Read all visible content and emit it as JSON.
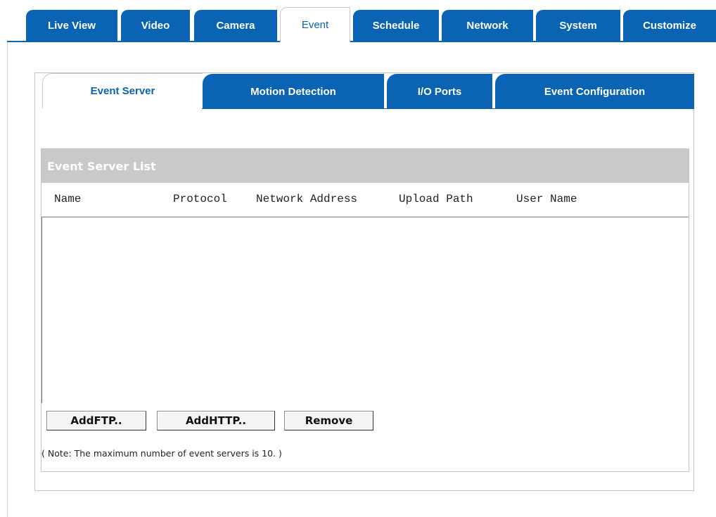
{
  "top_tabs": [
    "Live View",
    "Video",
    "Camera",
    "Event",
    "Schedule",
    "Network",
    "System",
    "Customize"
  ],
  "active_top_tab": "Event",
  "sub_tabs": [
    "Event Server",
    "Motion Detection",
    "I/O Ports",
    "Event Configuration"
  ],
  "active_sub_tab": "Event Server",
  "event_server_list": {
    "title": "Event Server List",
    "columns": [
      "Name",
      "Protocol",
      "Network Address",
      "Upload Path",
      "User Name"
    ],
    "rows": []
  },
  "buttons": {
    "add_ftp": "AddFTP..",
    "add_http": "AddHTTP..",
    "remove": "Remove"
  },
  "note": "( Note: The maximum number of event servers is 10. )",
  "colors": {
    "tab_blue": "#0b63b3",
    "list_header_gray": "#c9c9c9"
  }
}
